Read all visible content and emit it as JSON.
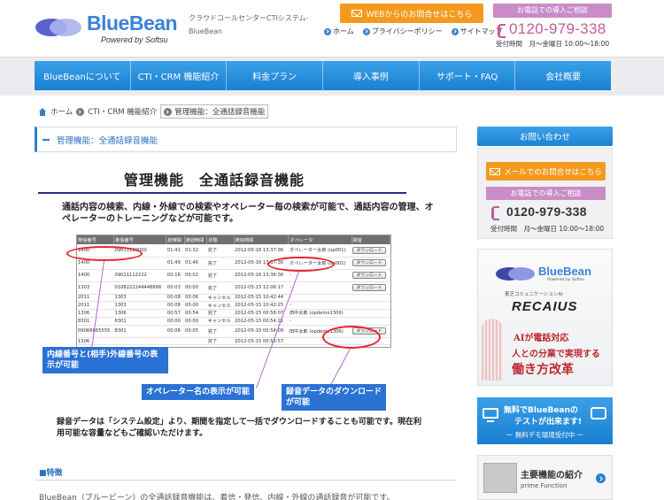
{
  "header": {
    "logo_name": "BlueBean",
    "logo_sub": "Powered by Softsu",
    "desc": "クラウドコールセンターCTIシステム-BlueBean",
    "web_contact": "WEBからのお問合せはこちら",
    "links": [
      "ホーム",
      "プライバシーポリシー",
      "サイトマップ"
    ],
    "tel_badge": "お電話での導入ご相談",
    "tel_number": "0120-979-338",
    "tel_hours": "受付時間　月～金曜日 10:00～18:00"
  },
  "nav": [
    "BlueBeanについて",
    "CTI・CRM 機能紹介",
    "料金プラン",
    "導入事例",
    "サポート・FAQ",
    "会社概要"
  ],
  "breadcrumb": {
    "home": "ホーム",
    "parent": "CTI・CRM 機能紹介",
    "current": "管理機能：全通話録音機能"
  },
  "page_head": "管理機能：全通話録音機能",
  "main": {
    "title": "管理機能　全通話録音機能",
    "desc": "通話内容の検索、内線・外線での検索やオペレーター毎の検索が可能で、通話内容の管理、オペレーターのトレーニングなどが可能です。",
    "callout_ext": "内線番号と(相手)外線番号の表示が可能",
    "callout_operator": "オペレーター名の表示が可能",
    "callout_download": "録音データのダウンロードが可能",
    "note": "録音データは「システム設定」より、期間を指定して一括でダウンロードすることも可能です。現在利用可能な容量などもご確認いただけます。",
    "section_title": "■特徴",
    "bottom_text": "BlueBean（ブルービーン）の全通話録音機能は、着信・発信、内線・外線の通話録音が可能です。"
  },
  "log_table": {
    "headers": [
      "発信番号",
      "着信番号",
      "総時間",
      "通話時間",
      "状態",
      "発信時間",
      "オペレータ",
      "録音"
    ],
    "rows": [
      [
        "1400",
        "09011110000",
        "01:41",
        "01:32",
        "完了",
        "2012-05-16 13:37:36",
        "オペレーター太郎 (op001)",
        "ダウンロード"
      ],
      [
        "1400",
        "",
        "01:49",
        "01:46",
        "完了",
        "2012-05-16 13:37:30",
        "オペレーター太郎 (op001)",
        "ダウンロード"
      ],
      [
        "1400",
        "09011112222",
        "00:16",
        "00:02",
        "完了",
        "2012-05-16 13:36:36",
        "-",
        "ダウンロード"
      ],
      [
        "1303",
        "0108222244446666",
        "00:03",
        "00:00",
        "完了",
        "2012-05-15 12:06:17",
        "-",
        "ダウンロード"
      ],
      [
        "2011",
        "1303",
        "00:08",
        "00:06",
        "キャンセル",
        "2012-05-15 10:42:44",
        "-",
        ""
      ],
      [
        "2011",
        "1303",
        "00:08",
        "00:00",
        "キャンセル",
        "2012-05-15 10:42:25",
        "-",
        ""
      ],
      [
        "1306",
        "1306",
        "00:57",
        "00:54",
        "完了",
        "2012-05-15 00:58:07",
        "田中太郎 (opdemo1306)",
        ""
      ],
      [
        "8301",
        "8301",
        "00:00",
        "00:00",
        "キャンセル",
        "2012-05-15 00:54:21",
        "-",
        ""
      ],
      [
        "09066665555",
        "8301",
        "00:06",
        "00:05",
        "完了",
        "2012-05-15 00:54:09",
        "田中太郎 (opdemo1306)",
        "ダウンロード"
      ],
      [
        "1306",
        "",
        "",
        "",
        "完了",
        "2012-05-15 00:53:57",
        "",
        ""
      ]
    ]
  },
  "sidebar": {
    "contact_head": "お問い合わせ",
    "mail_btn": "メールでのお問合せはこちら",
    "tel_badge": "お電話での導入ご相談",
    "tel_number": "0120-979-338",
    "tel_hours": "受付時間　月～金曜日 10:00～18:00",
    "ad_logo": "BlueBean",
    "ad_logo_sub": "Powered by Softsu",
    "ad_toshiba": "東芝コミュニケーションAI",
    "ad_recaius": "RECAIUS",
    "ad_line1": "AIが電話対応",
    "ad_line2": "人との分業で実現する",
    "ad_line3": "働き方改革",
    "trial_l1": "無料でBlueBeanの",
    "trial_l2": "テストが出来ます!",
    "trial_l3": "ー 無料デモ環境受付中 ー",
    "func_t1": "主要機能の紹介",
    "func_t2": "prime Function"
  }
}
